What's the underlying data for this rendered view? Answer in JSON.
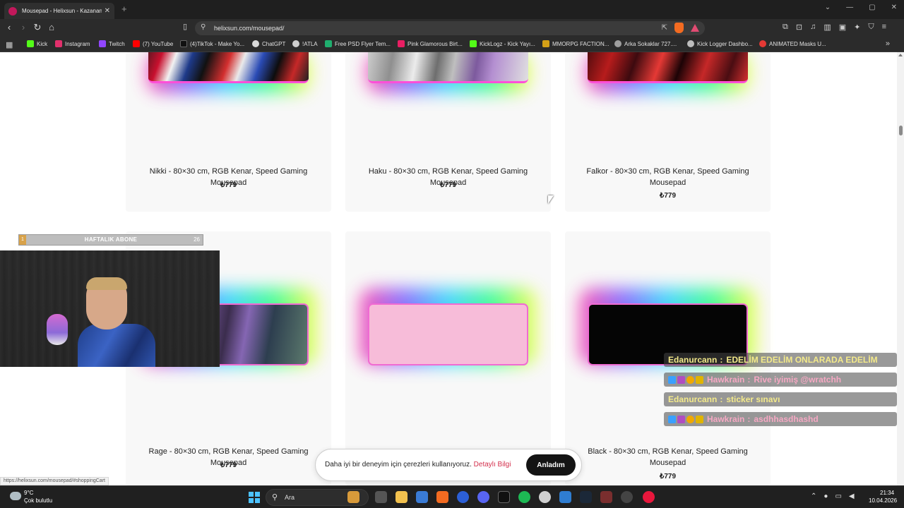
{
  "browser": {
    "tab_title": "Mousepad - Helixsun - Kazanan",
    "url": "helixsun.com/mousepad/",
    "bookmarks": [
      {
        "label": "Kick",
        "color": "#53fc18"
      },
      {
        "label": "Instagram",
        "color": "#e1306c"
      },
      {
        "label": "Twitch",
        "color": "#9146ff"
      },
      {
        "label": "(7) YouTube",
        "color": "#ff0000"
      },
      {
        "label": "(4)TikTok - Make Yo...",
        "color": "#111111"
      },
      {
        "label": "ChatGPT",
        "color": "#d9d9d9"
      },
      {
        "label": "!ATLA",
        "color": "#cfcfcf"
      },
      {
        "label": "Free PSD Flyer Tem...",
        "color": "#1fae6e"
      },
      {
        "label": "Pink Glamorous Birt...",
        "color": "#e91e63"
      },
      {
        "label": "KickLogz - Kick Yayı...",
        "color": "#53fc18"
      },
      {
        "label": "MMORPG FACTION...",
        "color": "#d4a017"
      },
      {
        "label": "Arka Sokaklar 727....",
        "color": "#9e9e9e"
      },
      {
        "label": "Kick Logger Dashbo...",
        "color": "#bdbdbd"
      },
      {
        "label": "ANIMATED Masks U...",
        "color": "#e53935"
      }
    ]
  },
  "products": [
    {
      "name": "Nikki - 80×30 cm, RGB Kenar, Speed Gaming Mousepad",
      "price": "₺779"
    },
    {
      "name": "Haku - 80×30 cm, RGB Kenar, Speed Gaming Mousepad",
      "price": "₺779"
    },
    {
      "name": "Falkor - 80×30 cm, RGB Kenar, Speed Gaming Mousepad",
      "price": "₺779"
    },
    {
      "name": "Rage - 80×30 cm, RGB Kenar, Speed Gaming Mousepad",
      "price": "₺779"
    },
    {
      "name": "",
      "price": ""
    },
    {
      "name": "Black - 80×30 cm, RGB Kenar, Speed Gaming Mousepad",
      "price": "₺779"
    }
  ],
  "cookie": {
    "text": "Daha iyi bir deneyim için çerezleri kullanıyoruz.",
    "link": "Detaylı Bilgi",
    "button": "Anladım"
  },
  "status_url": "https://helixsun.com/mousepad/#shoppingCart",
  "overlay": {
    "sub_label": "HAFTALIK ABONE",
    "sub_left": "1",
    "sub_right": "26",
    "chat": [
      {
        "user": "Edanurcann",
        "sep": ":",
        "message": "EDELİM EDELİM ONLARADA EDELİM",
        "user_color": "#f4ea8a",
        "msg_color": "#f4ea8a",
        "badges": false
      },
      {
        "user": "Hawkrain",
        "sep": ":",
        "message": "Rive iyimiş @wratchh",
        "user_color": "#f7a8c4",
        "msg_color": "#f7a8c4",
        "badges": true
      },
      {
        "user": "Edanurcann",
        "sep": ":",
        "message": "sticker sınavı",
        "user_color": "#f4ea8a",
        "msg_color": "#f4ea8a",
        "badges": false
      },
      {
        "user": "Hawkrain",
        "sep": ":",
        "message": "asdhhasdhashd",
        "user_color": "#f7a8c4",
        "msg_color": "#f7a8c4",
        "badges": true
      }
    ]
  },
  "taskbar": {
    "weather_temp": "9°C",
    "weather_desc": "Çok bulutlu",
    "search_placeholder": "Ara",
    "time": "21:34",
    "date": "10.04.2026"
  }
}
